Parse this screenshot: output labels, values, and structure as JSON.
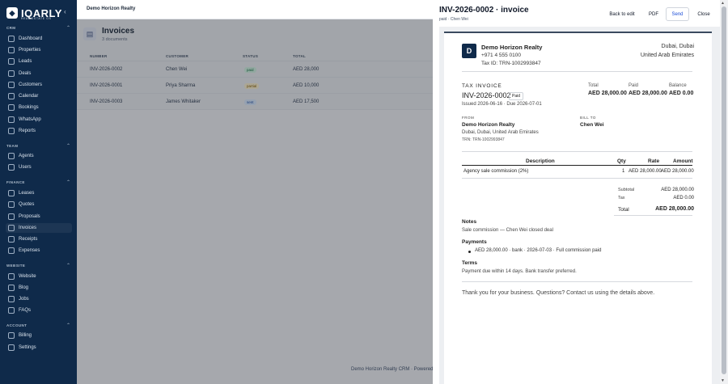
{
  "brand": {
    "logo_text": "IQARLY",
    "logo_sub": "REAL ESTATE OS"
  },
  "org_name": "Demo Horizon Realty",
  "sidebar": {
    "sections": [
      {
        "label": "CRM",
        "items": [
          "Dashboard",
          "Properties",
          "Leads",
          "Deals",
          "Customers",
          "Calendar",
          "Bookings",
          "WhatsApp",
          "Reports"
        ]
      },
      {
        "label": "TEAM",
        "items": [
          "Agents",
          "Users"
        ]
      },
      {
        "label": "FINANCE",
        "items": [
          "Leases",
          "Quotes",
          "Proposals",
          "Invoices",
          "Receipts",
          "Expenses"
        ]
      },
      {
        "label": "WEBSITE",
        "items": [
          "Website",
          "Blog",
          "Jobs",
          "FAQs"
        ]
      },
      {
        "label": "ACCOUNT",
        "items": [
          "Billing",
          "Settings"
        ]
      }
    ]
  },
  "list": {
    "title": "Invoices",
    "count": "3 documents",
    "columns": [
      "NUMBER",
      "CUSTOMER",
      "STATUS",
      "TOTAL"
    ],
    "rows": [
      {
        "number": "INV-2026-0002",
        "customer": "Chen Wei",
        "status": "paid",
        "total": "AED 28,000"
      },
      {
        "number": "INV-2026-0001",
        "customer": "Priya Sharma",
        "status": "partial",
        "total": "AED 10,000"
      },
      {
        "number": "INV-2026-0003",
        "customer": "James Whitaker",
        "status": "sent",
        "total": "AED 17,500"
      }
    ]
  },
  "footer": "Demo Horizon Realty CRM · Powered",
  "drawer": {
    "title": "INV-2026-0002 · invoice",
    "subtitle": "paid · Chen Wei",
    "buttons": {
      "back": "Back to edit",
      "pdf": "PDF",
      "send": "Send",
      "close": "Close"
    }
  },
  "invoice": {
    "logo_letter": "D",
    "company": "Demo Horizon Realty",
    "phone": "+971 4 555 0100",
    "tax_id": "Tax ID: TRN-1002993847",
    "city": "Dubai, Dubai",
    "country": "United Arab Emirates",
    "doc_type": "TAX INVOICE",
    "number": "INV-2026-0002",
    "status_badge": "Paid",
    "dates": "Issued 2026-06-16 · Due 2026-07-01",
    "summary": {
      "total_label": "Total",
      "total": "AED 28,000.00",
      "paid_label": "Paid",
      "paid": "AED 28,000.00",
      "balance_label": "Balance",
      "balance": "AED 0.00"
    },
    "from": {
      "label": "FROM",
      "name": "Demo Horizon Realty",
      "address": "Dubai, Dubai, United Arab Emirates",
      "trn": "TRN: TRN-1002993847"
    },
    "bill_to": {
      "label": "BILL TO",
      "name": "Chen Wei"
    },
    "items_columns": [
      "Description",
      "Qty",
      "Rate",
      "Amount"
    ],
    "items": [
      {
        "description": "Agency sale commission (2%)",
        "qty": "1",
        "rate": "AED 28,000.00",
        "amount": "AED 28,000.00"
      }
    ],
    "totals": {
      "subtotal_label": "Subtotal",
      "subtotal": "AED 28,000.00",
      "tax_label": "Tax",
      "tax": "AED 0.00",
      "total_label": "Total",
      "total": "AED 28,000.00"
    },
    "notes_label": "Notes",
    "notes": "Sale commission — Chen Wei closed deal",
    "payments_label": "Payments",
    "payment_line": "AED 28,000.00 · bank · 2026-07-03 · Full commission paid",
    "terms_label": "Terms",
    "terms": "Payment due within 14 days. Bank transfer preferred.",
    "thanks": "Thank you for your business. Questions? Contact us using the details above."
  }
}
